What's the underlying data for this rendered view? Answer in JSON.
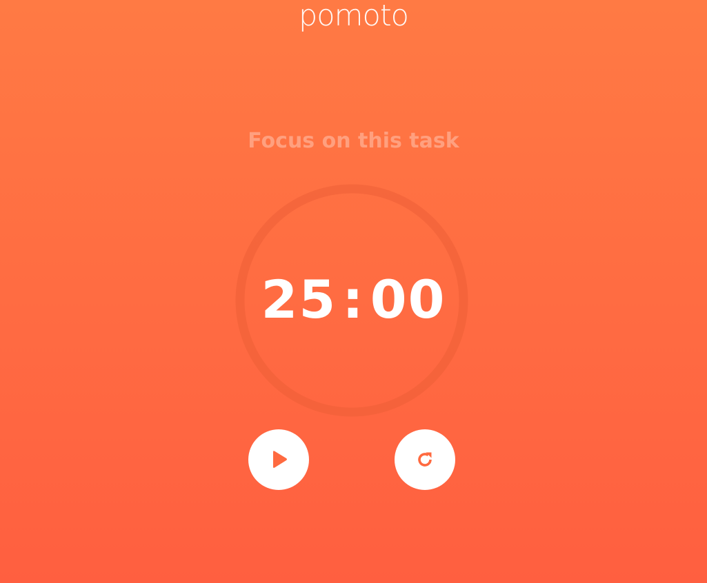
{
  "app": {
    "brand": "pomoto"
  },
  "task": {
    "label": "Focus on this task"
  },
  "timer": {
    "minutes": "25",
    "separator": ":",
    "seconds": "00"
  },
  "controls": {
    "play_icon": "play-icon",
    "reset_icon": "refresh-icon"
  },
  "colors": {
    "background_top": "#ff7a44",
    "background_bottom": "#ff5f40",
    "accent": "#ff6a40",
    "ring": "#f06038",
    "text": "#ffffff"
  }
}
